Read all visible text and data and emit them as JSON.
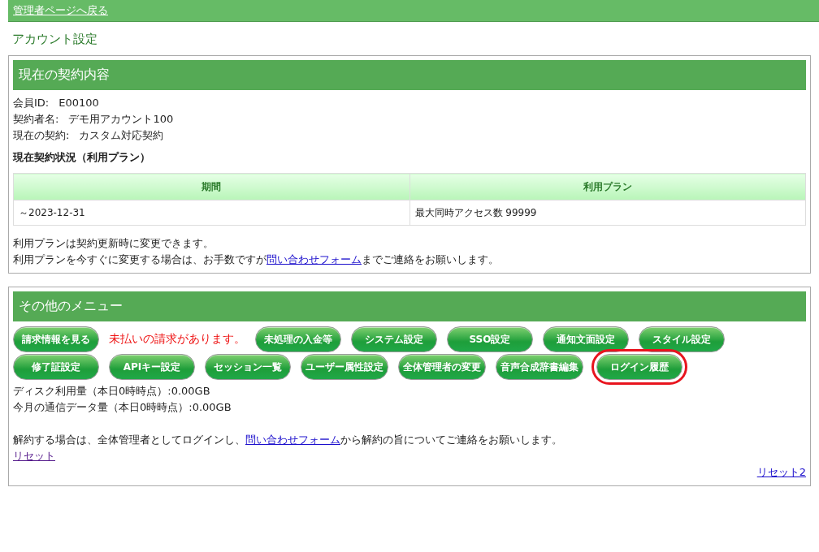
{
  "top_bar": {
    "back_link": "管理者ページへ戻る"
  },
  "page_title": "アカウント設定",
  "contract_panel": {
    "heading": "現在の契約内容",
    "fields": [
      {
        "label": "会員ID:",
        "value": "E00100"
      },
      {
        "label": "契約者名:",
        "value": "デモ用アカウント100"
      },
      {
        "label": "現在の契約:",
        "value": "カスタム対応契約"
      }
    ],
    "subheading": "現在契約状況（利用プラン）",
    "table": {
      "columns": [
        "期間",
        "利用プラン"
      ],
      "rows": [
        [
          "～2023-12-31",
          "最大同時アクセス数 99999"
        ]
      ]
    },
    "note_1": "利用プランは契約更新時に変更できます。",
    "note_2": {
      "before": "利用プランを今すぐに変更する場合は、お手数ですが",
      "link": "問い合わせフォーム",
      "after": "までご連絡をお願いします。"
    }
  },
  "menu_panel": {
    "heading": "その他のメニュー",
    "items": [
      {
        "kind": "button",
        "label": "請求情報を見る",
        "highlighted": false
      },
      {
        "kind": "notice",
        "label": "未払いの請求があります。"
      },
      {
        "kind": "button",
        "label": "未処理の入金等",
        "highlighted": false
      },
      {
        "kind": "button",
        "label": "システム設定",
        "highlighted": false
      },
      {
        "kind": "button",
        "label": "SSO設定",
        "highlighted": false
      },
      {
        "kind": "button",
        "label": "通知文面設定",
        "highlighted": false
      },
      {
        "kind": "button",
        "label": "スタイル設定",
        "highlighted": false
      },
      {
        "kind": "button",
        "label": "修了証設定",
        "highlighted": false
      },
      {
        "kind": "button",
        "label": "APIキー設定",
        "highlighted": false
      },
      {
        "kind": "button",
        "label": "セッション一覧",
        "highlighted": false
      },
      {
        "kind": "button",
        "label": "ユーザー属性設定",
        "highlighted": false
      },
      {
        "kind": "button",
        "label": "全体管理者の変更",
        "highlighted": false
      },
      {
        "kind": "button",
        "label": "音声合成辞書編集",
        "highlighted": false
      },
      {
        "kind": "button",
        "label": "ログイン履歴",
        "highlighted": true
      }
    ],
    "usage": [
      "ディスク利用量（本日0時時点）:0.00GB",
      "今月の通信データ量（本日0時時点）:0.00GB"
    ],
    "cancel_note": {
      "before": "解約する場合は、全体管理者としてログインし、",
      "link": "問い合わせフォーム",
      "after": "から解約の旨についてご連絡をお願いします。"
    },
    "reset_link": "リセット",
    "reset2_link": "リセット2"
  }
}
